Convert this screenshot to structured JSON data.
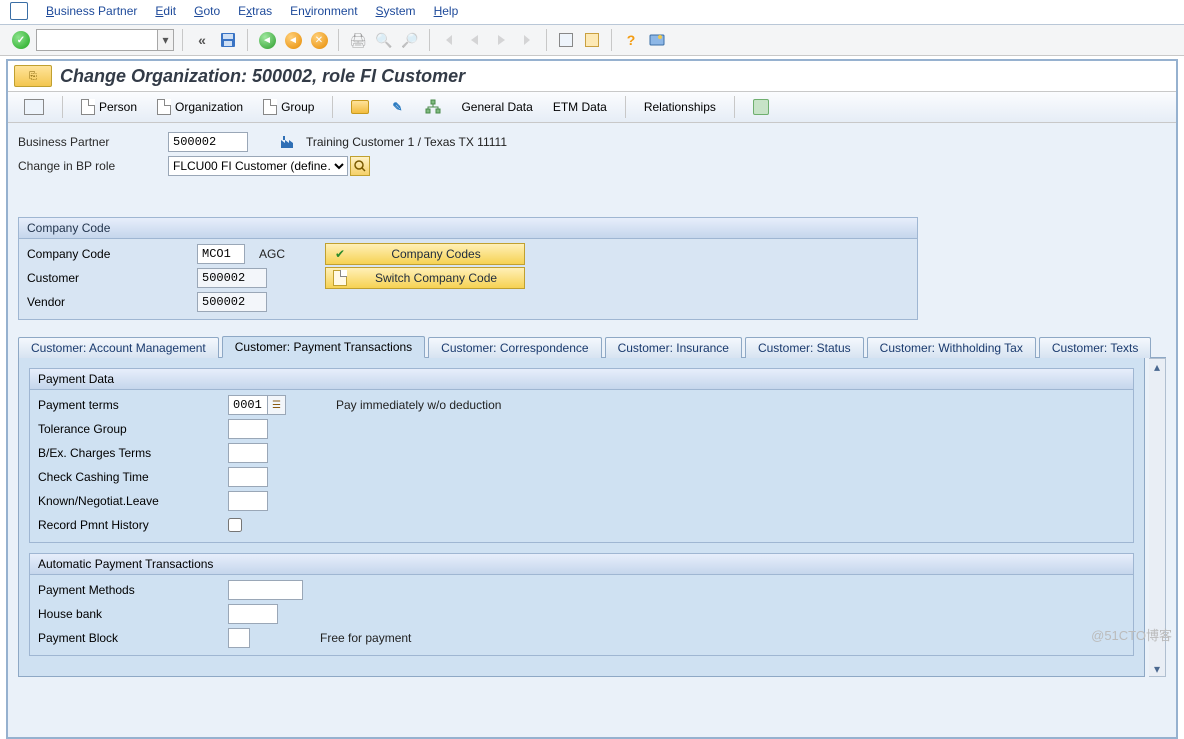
{
  "menu": {
    "items": [
      {
        "label": "Business Partner",
        "ul": "B"
      },
      {
        "label": "Edit",
        "ul": "E"
      },
      {
        "label": "Goto",
        "ul": "G"
      },
      {
        "label": "Extras",
        "ul": "E"
      },
      {
        "label": "Environment",
        "ul": "E"
      },
      {
        "label": "System",
        "ul": "S"
      },
      {
        "label": "Help",
        "ul": "H"
      }
    ]
  },
  "toolbar": {
    "command_value": "",
    "back_glyph": "«"
  },
  "title": "Change Organization: 500002, role FI Customer",
  "subtoolbar": {
    "person": "Person",
    "organization": "Organization",
    "group": "Group",
    "general_data": "General Data",
    "etm_data": "ETM Data",
    "relationships": "Relationships"
  },
  "header": {
    "bp_label": "Business Partner",
    "bp_value": "500002",
    "bp_desc": "Training Customer 1 / Texas TX 11111",
    "role_label": "Change in BP role",
    "role_value": "FLCU00 FI Customer (define…"
  },
  "companycode": {
    "title": "Company Code",
    "cc_label": "Company Code",
    "cc_value": "MCO1",
    "cc_desc": "AGC",
    "btn_codes": "Company Codes",
    "btn_switch": "Switch Company Code",
    "cust_label": "Customer",
    "cust_value": "500002",
    "vend_label": "Vendor",
    "vend_value": "500002"
  },
  "tabs": [
    "Customer: Account Management",
    "Customer: Payment Transactions",
    "Customer: Correspondence",
    "Customer: Insurance",
    "Customer: Status",
    "Customer: Withholding Tax",
    "Customer: Texts"
  ],
  "active_tab_index": 1,
  "payment_data": {
    "title": "Payment Data",
    "terms_label": "Payment terms",
    "terms_value": "0001",
    "terms_desc": "Pay immediately w/o deduction",
    "tol_label": "Tolerance Group",
    "bex_label": "B/Ex. Charges Terms",
    "cct_label": "Check Cashing Time",
    "knl_label": "Known/Negotiat.Leave",
    "rph_label": "Record Pmnt History"
  },
  "auto_pay": {
    "title": "Automatic Payment Transactions",
    "methods_label": "Payment Methods",
    "house_label": "House bank",
    "block_label": "Payment Block",
    "block_desc": "Free for payment"
  },
  "watermark": "@51CTO博客"
}
